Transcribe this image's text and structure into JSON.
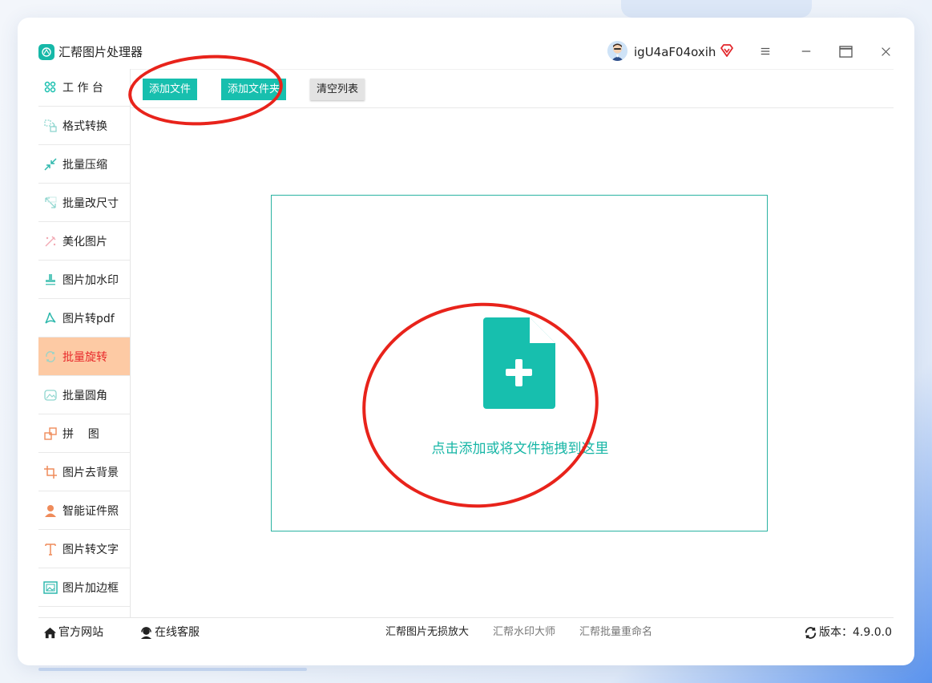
{
  "app": {
    "title": "汇帮图片处理器",
    "username": "igU4aF04oxih"
  },
  "sidebar": {
    "items": [
      {
        "label": "工 作 台",
        "icon": "grid-icon"
      },
      {
        "label": "格式转换",
        "icon": "convert-icon"
      },
      {
        "label": "批量压缩",
        "icon": "compress-icon"
      },
      {
        "label": "批量改尺寸",
        "icon": "resize-icon"
      },
      {
        "label": "美化图片",
        "icon": "beautify-icon"
      },
      {
        "label": "图片加水印",
        "icon": "stamp-icon"
      },
      {
        "label": "图片转pdf",
        "icon": "pdf-icon"
      },
      {
        "label": "批量旋转",
        "icon": "rotate-icon",
        "active": true
      },
      {
        "label": "批量圆角",
        "icon": "round-corner-icon"
      },
      {
        "label": "拼    图",
        "icon": "puzzle-icon"
      },
      {
        "label": "图片去背景",
        "icon": "crop-icon"
      },
      {
        "label": "智能证件照",
        "icon": "person-icon"
      },
      {
        "label": "图片转文字",
        "icon": "text-icon"
      },
      {
        "label": "图片加边框",
        "icon": "frame-icon"
      }
    ]
  },
  "toolbar": {
    "add_file": "添加文件",
    "add_folder": "添加文件夹",
    "clear_list": "清空列表"
  },
  "dropzone": {
    "text": "点击添加或将文件拖拽到这里"
  },
  "footer": {
    "website": "官方网站",
    "service": "在线客服",
    "link1": "汇帮图片无损放大",
    "link2": "汇帮水印大师",
    "link3": "汇帮批量重命名",
    "version": "版本：4.9.0.0"
  },
  "colors": {
    "accent": "#17bfae",
    "active_bg": "#fdcaa4",
    "active_text": "#e8292b",
    "annotation": "#e8231b"
  }
}
